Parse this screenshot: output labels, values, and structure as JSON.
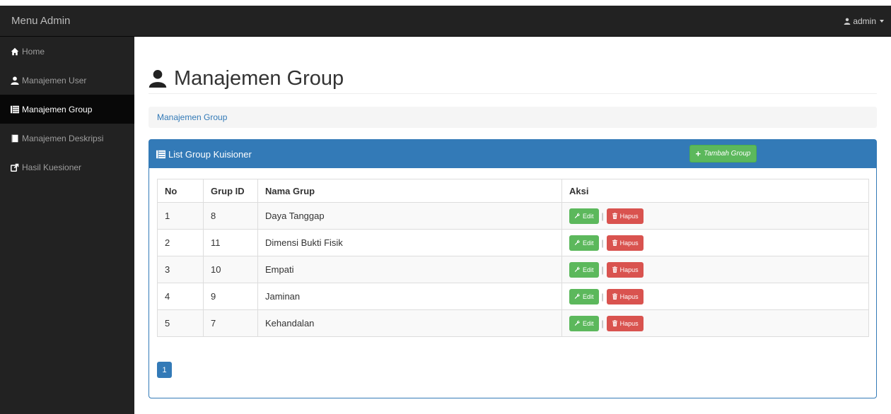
{
  "navbar": {
    "brand": "Menu Admin",
    "user_label": "admin"
  },
  "sidebar": {
    "items": [
      {
        "label": "Home",
        "icon": "home-icon"
      },
      {
        "label": "Manajemen User",
        "icon": "user-icon"
      },
      {
        "label": "Manajemen Group",
        "icon": "list-icon",
        "active": true
      },
      {
        "label": "Manajemen Deskripsi",
        "icon": "book-icon"
      },
      {
        "label": "Hasil Kuesioner",
        "icon": "share-icon"
      }
    ]
  },
  "main": {
    "page_title": "Manajemen Group",
    "breadcrumb": "Manajemen Group",
    "panel": {
      "title": "List Group Kuisioner",
      "add_button_label": "Tambah Group",
      "table": {
        "headers": [
          "No",
          "Grup ID",
          "Nama Grup",
          "Aksi"
        ],
        "rows": [
          {
            "no": "1",
            "id": "8",
            "nama": "Daya Tanggap"
          },
          {
            "no": "2",
            "id": "11",
            "nama": "Dimensi Bukti Fisik"
          },
          {
            "no": "3",
            "id": "10",
            "nama": "Empati"
          },
          {
            "no": "4",
            "id": "9",
            "nama": "Jaminan"
          },
          {
            "no": "5",
            "id": "7",
            "nama": "Kehandalan"
          }
        ],
        "edit_label": "Edit",
        "delete_label": "Hapus",
        "separator": "|"
      },
      "pagination": {
        "current_page": "1"
      }
    }
  },
  "colors": {
    "navbar_bg": "#222222",
    "sidebar_active_bg": "#080808",
    "primary": "#337ab7",
    "success": "#5cb85c",
    "danger": "#d9534f"
  }
}
